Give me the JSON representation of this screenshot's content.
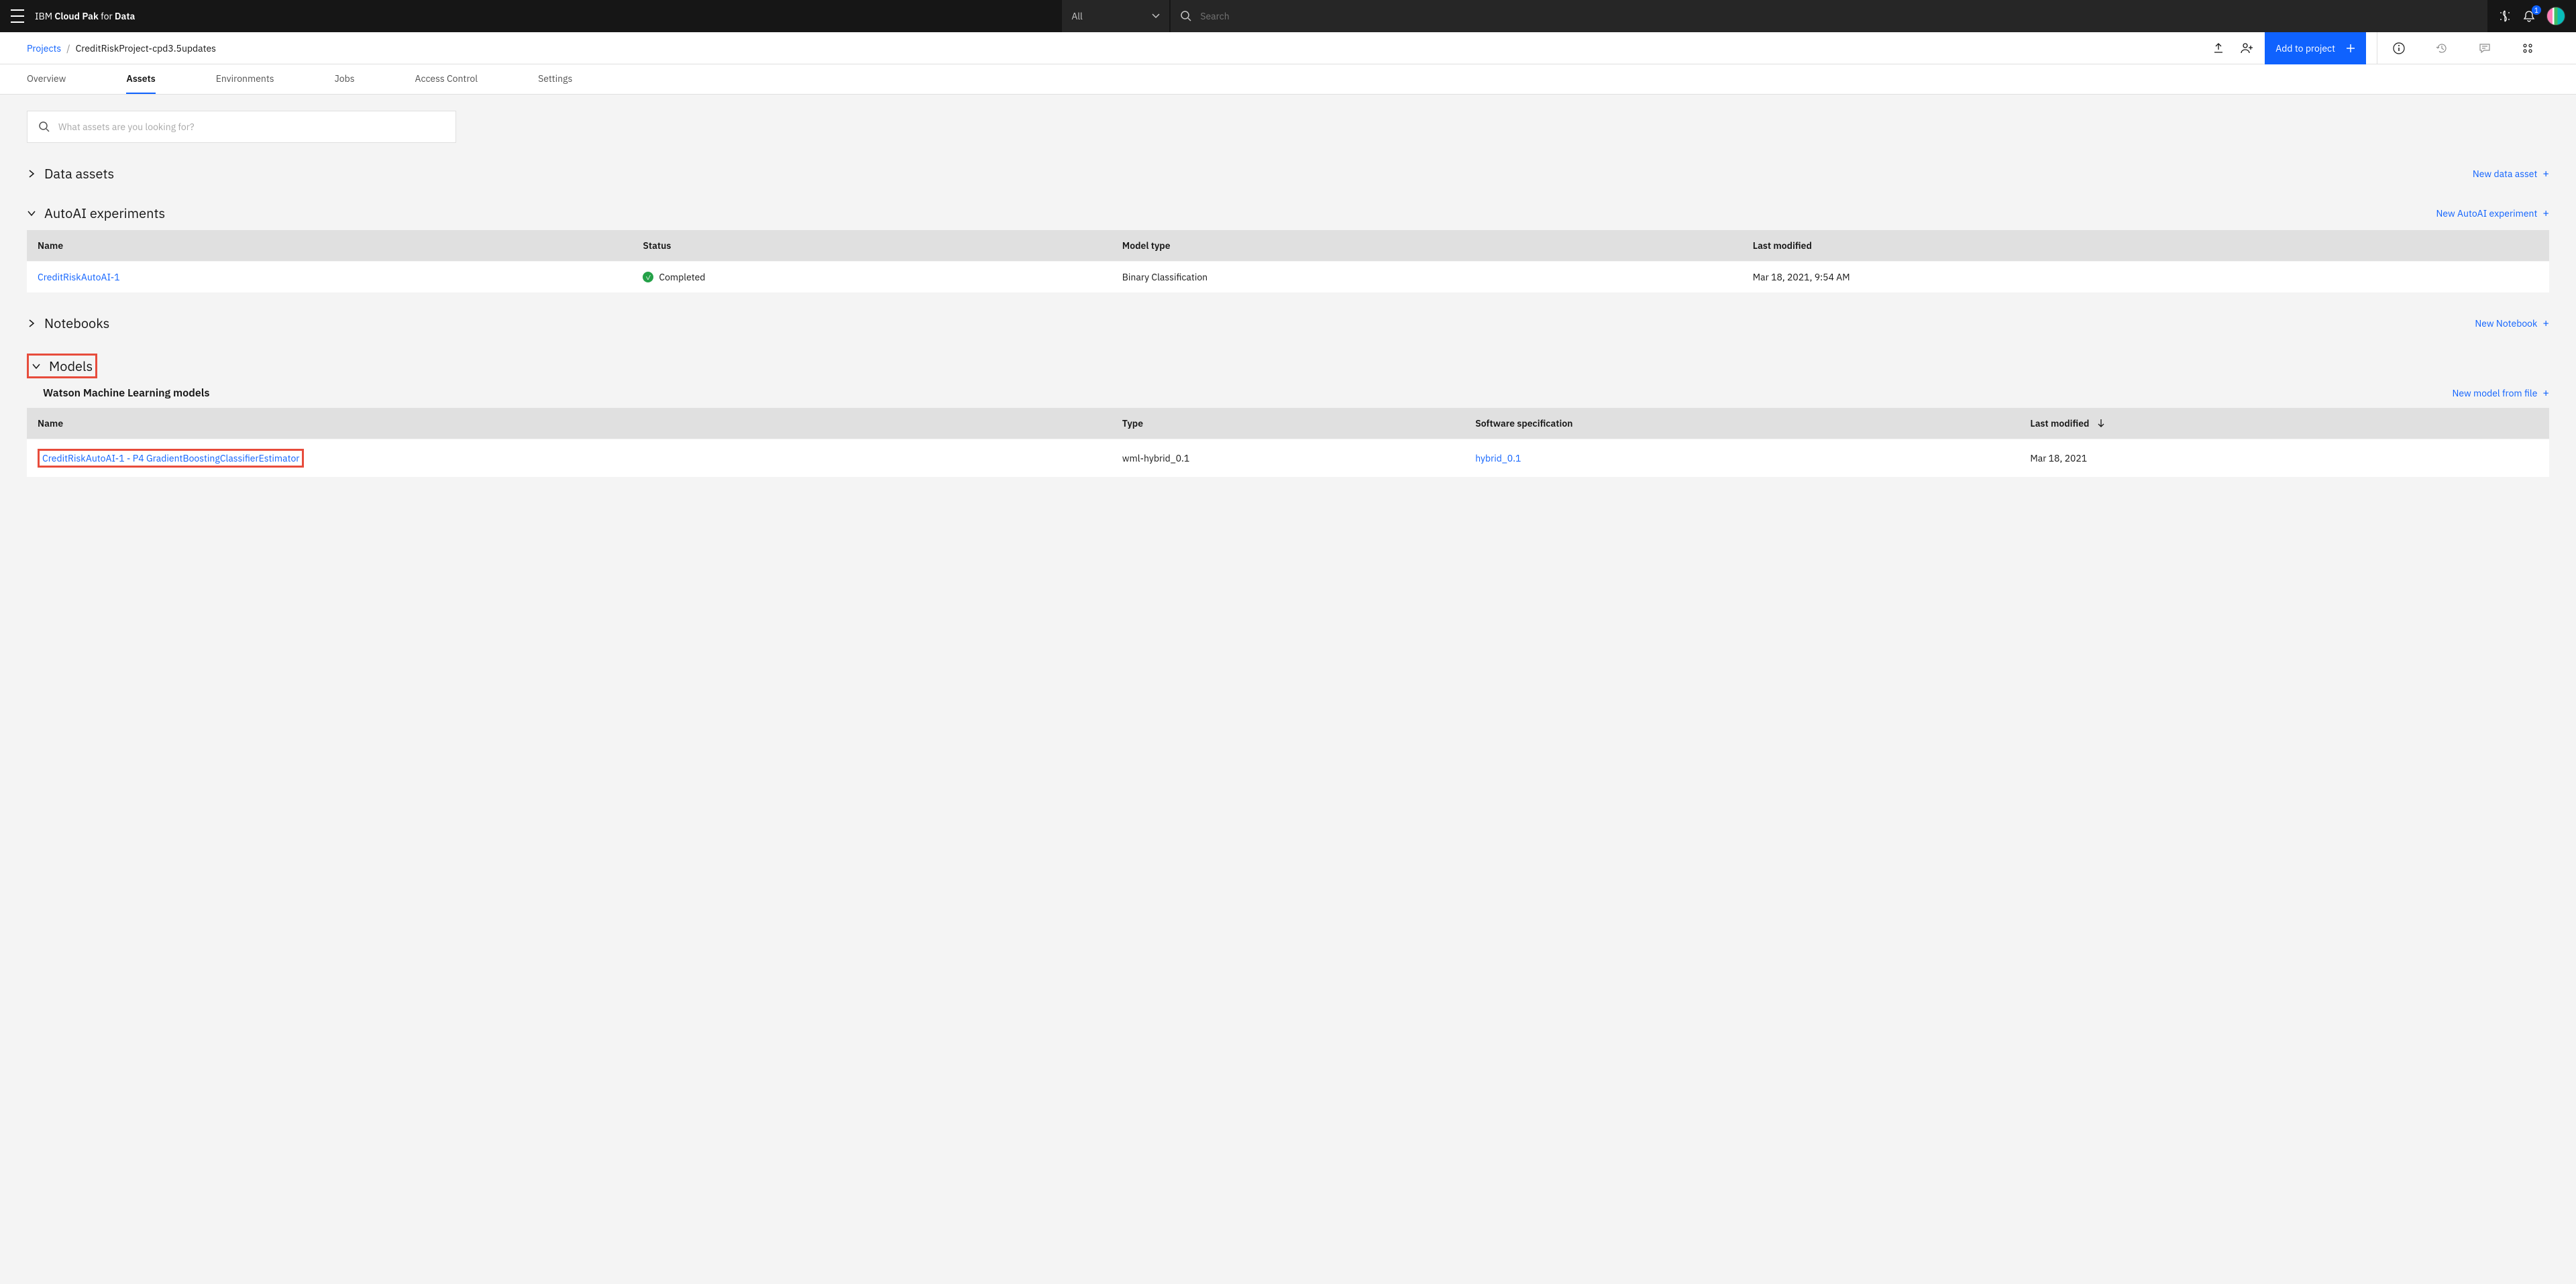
{
  "topbar": {
    "brand_prefix": "IBM ",
    "brand_bold": "Cloud Pak ",
    "brand_suffix": "for ",
    "brand_bold2": "Data",
    "filter_label": "All",
    "search_placeholder": "Search",
    "notif_count": "1"
  },
  "breadcrumb": {
    "root": "Projects",
    "sep": "/",
    "current": "CreditRiskProject-cpd3.5updates"
  },
  "toolbar": {
    "add_label": "Add to project"
  },
  "tabs": {
    "t0": "Overview",
    "t1": "Assets",
    "t2": "Environments",
    "t3": "Jobs",
    "t4": "Access Control",
    "t5": "Settings"
  },
  "search": {
    "placeholder": "What assets are you looking for?"
  },
  "sections": {
    "data_assets": {
      "title": "Data assets",
      "action": "New data asset"
    },
    "autoai": {
      "title": "AutoAI experiments",
      "action": "New AutoAI experiment",
      "cols": {
        "c0": "Name",
        "c1": "Status",
        "c2": "Model type",
        "c3": "Last modified"
      },
      "row0": {
        "name": "CreditRiskAutoAI-1",
        "status": "Completed",
        "model_type": "Binary Classification",
        "modified": "Mar 18, 2021, 9:54 AM"
      }
    },
    "notebooks": {
      "title": "Notebooks",
      "action": "New Notebook"
    },
    "models": {
      "title": "Models",
      "subhead": "Watson Machine Learning models",
      "action": "New model from file",
      "cols": {
        "c0": "Name",
        "c1": "Type",
        "c2": "Software specification",
        "c3": "Last modified"
      },
      "row0": {
        "name": "CreditRiskAutoAI-1 - P4 GradientBoostingClassifierEstimator",
        "type": "wml-hybrid_0.1",
        "spec": "hybrid_0.1",
        "modified": "Mar 18, 2021"
      }
    }
  }
}
